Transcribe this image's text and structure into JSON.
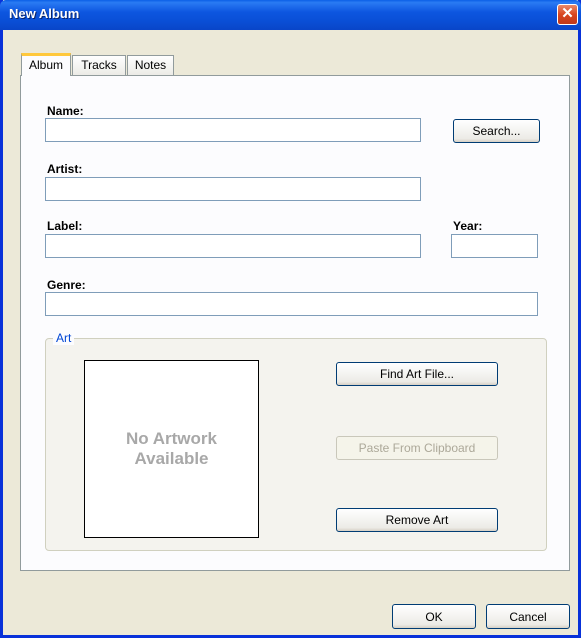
{
  "window": {
    "title": "New Album"
  },
  "tabs": [
    {
      "label": "Album",
      "active": true
    },
    {
      "label": "Tracks",
      "active": false
    },
    {
      "label": "Notes",
      "active": false
    }
  ],
  "form": {
    "name_label": "Name:",
    "name_value": "",
    "search_button": "Search...",
    "artist_label": "Artist:",
    "artist_value": "",
    "label_label": "Label:",
    "label_value": "",
    "year_label": "Year:",
    "year_value": "",
    "genre_label": "Genre:",
    "genre_value": ""
  },
  "art": {
    "group_title": "Art",
    "placeholder": "No Artwork\nAvailable",
    "find_button": "Find Art File...",
    "paste_button": "Paste From Clipboard",
    "paste_enabled": false,
    "remove_button": "Remove Art"
  },
  "footer": {
    "ok_button": "OK",
    "cancel_button": "Cancel"
  },
  "colors": {
    "titlebar": "#0a4fd6",
    "tab_highlight": "#ffc83c",
    "group_title": "#0046d5"
  }
}
